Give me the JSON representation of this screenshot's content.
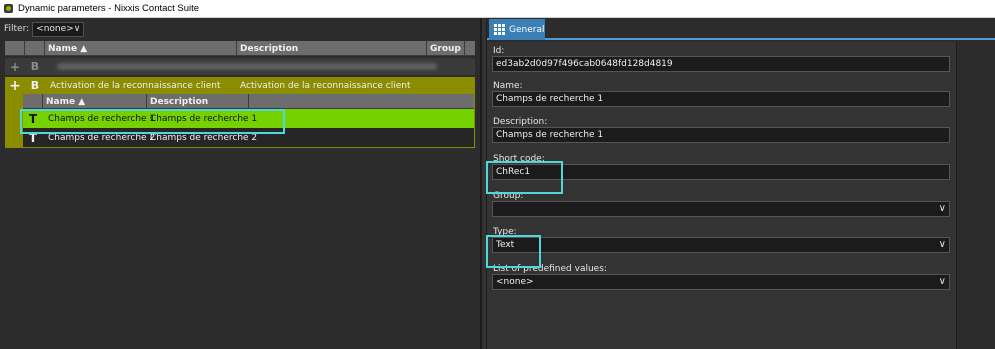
{
  "window": {
    "title": "Dynamic parameters - Nixxis Contact Suite"
  },
  "filter": {
    "label": "Filter:",
    "value": "<none>"
  },
  "grid": {
    "headers": {
      "name": "Name ▲",
      "description": "Description",
      "group": "Group"
    },
    "group_row": {
      "icon": "B",
      "name": "Activation de la reconnaissance client",
      "description": "Activation de la reconnaissance client"
    },
    "sub_headers": {
      "name": "Name ▲",
      "description": "Description"
    },
    "rows": [
      {
        "icon": "T",
        "name": "Champs de recherche 1",
        "description": "Champs de recherche 1",
        "selected": true
      },
      {
        "icon": "T",
        "name": "Champs de recherche 2",
        "description": "Champs de recherche 2",
        "selected": false
      }
    ]
  },
  "tab": {
    "label": "General"
  },
  "form": {
    "id": {
      "label": "Id:",
      "value": "ed3ab2d0d97f496cab0648fd128d4819"
    },
    "name": {
      "label": "Name:",
      "value": "Champs de recherche 1"
    },
    "description": {
      "label": "Description:",
      "value": "Champs de recherche 1"
    },
    "short_code": {
      "label": "Short code:",
      "value": "ChRec1"
    },
    "group": {
      "label": "Group:",
      "value": ""
    },
    "type": {
      "label": "Type:",
      "value": "Text"
    },
    "predefined": {
      "label": "List of predefined values:",
      "value": "<none>"
    }
  },
  "icons": {
    "app": "app-icon",
    "expand": "plus-icon",
    "boolean": "b-type-icon",
    "text": "t-type-icon",
    "dropdown": "chevron-down-icon",
    "tab": "grid-icon"
  },
  "colors": {
    "accent": "#3b7fb7",
    "group_band": "#8c8c00",
    "selected_row": "#76d100",
    "highlight": "#4fd8d8"
  }
}
